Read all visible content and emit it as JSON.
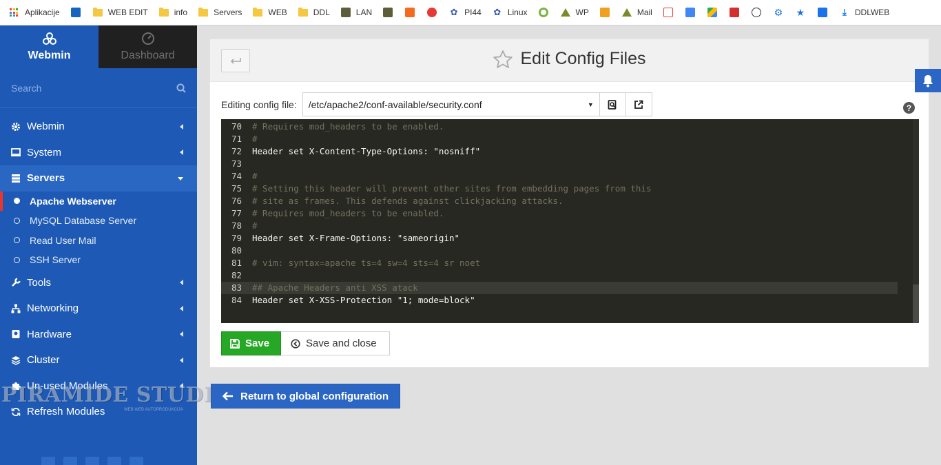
{
  "bookmarks": [
    {
      "label": "Aplikacije",
      "icon": "apps-grid-icon"
    },
    {
      "label": "",
      "icon": "radio-icon",
      "color": "#1565c0"
    },
    {
      "label": "WEB EDIT",
      "icon": "folder-icon"
    },
    {
      "label": "info",
      "icon": "folder-icon"
    },
    {
      "label": "Servers",
      "icon": "folder-icon"
    },
    {
      "label": "WEB",
      "icon": "folder-icon"
    },
    {
      "label": "DDL",
      "icon": "folder-icon"
    },
    {
      "label": "LAN",
      "icon": "lan-icon"
    },
    {
      "label": "",
      "icon": "lan2-icon"
    },
    {
      "label": "",
      "icon": "orange-x-icon",
      "color": "#f26b21"
    },
    {
      "label": "",
      "icon": "t-logo-icon",
      "color": "#e53935"
    },
    {
      "label": "PI44",
      "icon": "webmin-logo-icon"
    },
    {
      "label": "Linux",
      "icon": "webmin-logo-icon"
    },
    {
      "label": "",
      "icon": "green-ring-icon",
      "color": "#7cb342"
    },
    {
      "label": "WP",
      "icon": "triangle-icon"
    },
    {
      "label": "",
      "icon": "pma-icon"
    },
    {
      "label": "Mail",
      "icon": "triangle-icon"
    },
    {
      "label": "",
      "icon": "gmail-icon"
    },
    {
      "label": "",
      "icon": "translate-icon",
      "color": "#4285f4"
    },
    {
      "label": "",
      "icon": "drive-icon"
    },
    {
      "label": "",
      "icon": "calendar-icon",
      "color": "#d32f2f"
    },
    {
      "label": "",
      "icon": "gauge-icon"
    },
    {
      "label": "",
      "icon": "gear-icon",
      "color": "#1a73e8"
    },
    {
      "label": "",
      "icon": "star-icon",
      "color": "#1a73e8"
    },
    {
      "label": "",
      "icon": "puzzle-icon",
      "color": "#1a73e8"
    },
    {
      "label": "DDLWEB",
      "icon": "download-icon"
    }
  ],
  "sidebar": {
    "tabs": [
      {
        "label": "Webmin",
        "icon": "webmin-logo-icon"
      },
      {
        "label": "Dashboard",
        "icon": "dashboard-gauge-icon"
      }
    ],
    "search_placeholder": "Search",
    "items": [
      {
        "label": "Webmin",
        "icon": "gear-icon"
      },
      {
        "label": "System",
        "icon": "monitor-icon"
      },
      {
        "label": "Servers",
        "icon": "server-icon"
      },
      {
        "label": "Tools",
        "icon": "wrench-icon"
      },
      {
        "label": "Networking",
        "icon": "network-icon"
      },
      {
        "label": "Hardware",
        "icon": "harddisk-icon"
      },
      {
        "label": "Cluster",
        "icon": "layers-icon"
      },
      {
        "label": "Un-used Modules",
        "icon": "puzzle-icon"
      },
      {
        "label": "Refresh Modules",
        "icon": "refresh-icon"
      }
    ],
    "servers_sub": [
      {
        "label": "Apache Webserver"
      },
      {
        "label": "MySQL Database Server"
      },
      {
        "label": "Read User Mail"
      },
      {
        "label": "SSH Server"
      }
    ],
    "watermark": "PIRAMIDE STUDIO",
    "watermark_sub": "WEB WEB AUTOPRODUKCIJA"
  },
  "panel": {
    "title": "Edit Config Files",
    "file_label": "Editing config file:",
    "file_value": "/etc/apache2/conf-available/security.conf",
    "editor_lines": [
      {
        "n": "70",
        "text": "# Requires mod_headers to be enabled.",
        "kind": "comment"
      },
      {
        "n": "71",
        "text": "#",
        "kind": "comment"
      },
      {
        "n": "72",
        "text": "Header set X-Content-Type-Options: \"nosniff\"",
        "kind": "text"
      },
      {
        "n": "73",
        "text": "",
        "kind": "text"
      },
      {
        "n": "74",
        "text": "#",
        "kind": "comment"
      },
      {
        "n": "75",
        "text": "# Setting this header will prevent other sites from embedding pages from this",
        "kind": "comment"
      },
      {
        "n": "76",
        "text": "# site as frames. This defends against clickjacking attacks.",
        "kind": "comment"
      },
      {
        "n": "77",
        "text": "# Requires mod_headers to be enabled.",
        "kind": "comment"
      },
      {
        "n": "78",
        "text": "#",
        "kind": "comment"
      },
      {
        "n": "79",
        "text": "Header set X-Frame-Options: \"sameorigin\"",
        "kind": "text"
      },
      {
        "n": "80",
        "text": "",
        "kind": "text"
      },
      {
        "n": "81",
        "text": "# vim: syntax=apache ts=4 sw=4 sts=4 sr noet",
        "kind": "comment"
      },
      {
        "n": "82",
        "text": "",
        "kind": "text"
      },
      {
        "n": "83",
        "text": "## Apache Headers anti XSS atack",
        "kind": "comment",
        "highlight": true
      },
      {
        "n": "84",
        "text": "Header set X-XSS-Protection \"1; mode=block\"",
        "kind": "text"
      }
    ],
    "save_label": "Save",
    "save_close_label": "Save and close"
  },
  "return_label": "Return to global configuration",
  "colors": {
    "sidebar": "#1e5ab5",
    "save_green": "#26a826",
    "return_blue": "#2b66c4",
    "editor_bg": "#272822"
  }
}
